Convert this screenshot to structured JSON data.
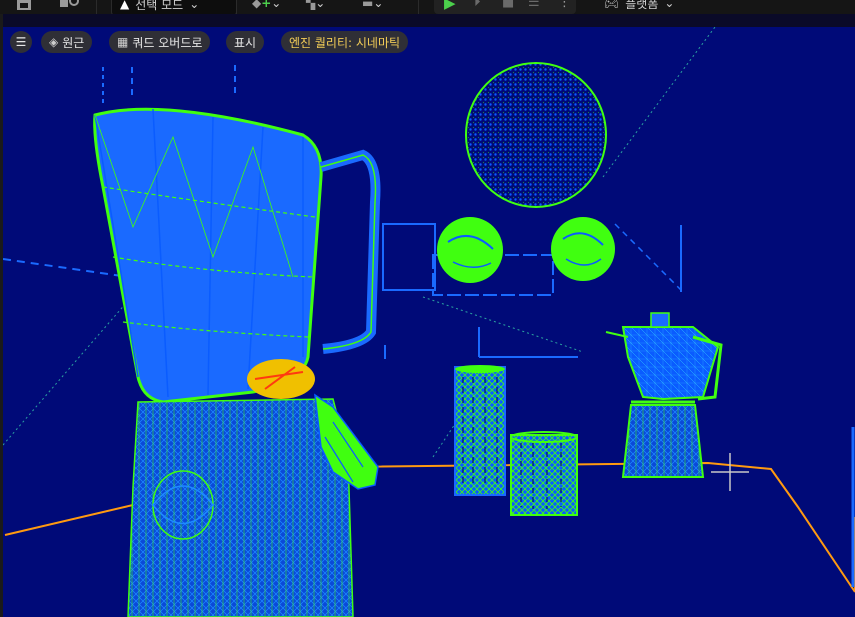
{
  "toolbar": {
    "mode_label": "선택 모드",
    "platform_label": "플랫폼"
  },
  "viewport_bar": {
    "perspective_label": "원근",
    "view_mode_label": "쿼드 오버드로",
    "show_label": "표시",
    "quality_label": "엔진 퀄리티: 시네마틱"
  },
  "colors": {
    "viewport_bg": "#000a78",
    "wire_blue": "#0a5cff",
    "wire_green": "#40ff10",
    "floor_orange": "#ff9a10",
    "accent_yellow": "#f2cc57"
  }
}
